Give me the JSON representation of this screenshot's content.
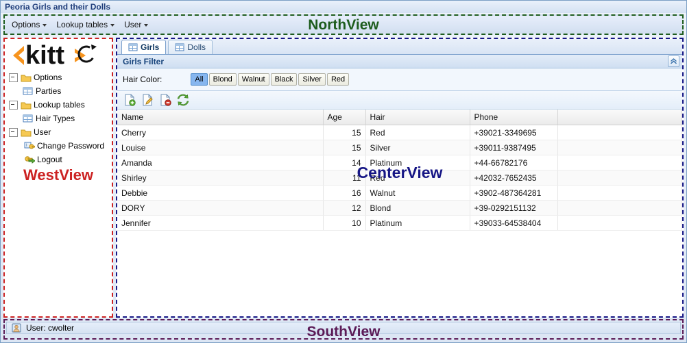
{
  "window": {
    "title": "Peoria Girls and their Dolls"
  },
  "regions": {
    "north_label": "NorthView",
    "west_label": "WestView",
    "center_label": "CenterView",
    "south_label": "SouthView",
    "north_color": "#1d5c1d",
    "west_color": "#cc2222",
    "center_color": "#161685",
    "south_color": "#5b1a56"
  },
  "menu": {
    "items": [
      {
        "label": "Options",
        "has_caret": true
      },
      {
        "label": "Lookup tables",
        "has_caret": true
      },
      {
        "label": "User",
        "has_caret": true
      }
    ]
  },
  "logo": {
    "text": "kitt",
    "accent_color": "#f7941e"
  },
  "tree": {
    "nodes": [
      {
        "label": "Options",
        "icon": "folder-icon",
        "type": "folder",
        "expanded": true,
        "level": 0
      },
      {
        "label": "Parties",
        "icon": "table-icon",
        "type": "leaf",
        "level": 1
      },
      {
        "label": "Lookup tables",
        "icon": "folder-icon",
        "type": "folder",
        "expanded": true,
        "level": 0
      },
      {
        "label": "Hair Types",
        "icon": "table-icon",
        "type": "leaf",
        "level": 1
      },
      {
        "label": "User",
        "icon": "folder-icon",
        "type": "folder",
        "expanded": true,
        "level": 0
      },
      {
        "label": "Change Password",
        "icon": "key-icon",
        "type": "leaf",
        "level": 1
      },
      {
        "label": "Logout",
        "icon": "logout-key-icon",
        "type": "leaf",
        "level": 1
      }
    ]
  },
  "tabs": [
    {
      "label": "Girls",
      "icon": "table-icon",
      "active": true
    },
    {
      "label": "Dolls",
      "icon": "table-icon",
      "active": false
    }
  ],
  "filter": {
    "title": "Girls Filter",
    "collapse_icon": "chevron-double-up-icon",
    "hair_color_label": "Hair Color:",
    "options": [
      {
        "label": "All",
        "selected": true
      },
      {
        "label": "Blond",
        "selected": false
      },
      {
        "label": "Walnut",
        "selected": false
      },
      {
        "label": "Black",
        "selected": false
      },
      {
        "label": "Silver",
        "selected": false
      },
      {
        "label": "Red",
        "selected": false
      }
    ]
  },
  "toolbar": {
    "buttons": [
      {
        "name": "new-record-button",
        "icon": "page-add-icon"
      },
      {
        "name": "edit-record-button",
        "icon": "page-edit-icon"
      },
      {
        "name": "delete-record-button",
        "icon": "page-delete-icon"
      },
      {
        "name": "refresh-button",
        "icon": "refresh-icon"
      }
    ]
  },
  "table": {
    "columns": [
      "Name",
      "Age",
      "Hair",
      "Phone",
      ""
    ],
    "rows": [
      {
        "name": "Cherry",
        "age": "15",
        "hair": "Red",
        "phone": "+39021-3349695"
      },
      {
        "name": "Louise",
        "age": "15",
        "hair": "Silver",
        "phone": "+39011-9387495"
      },
      {
        "name": "Amanda",
        "age": "14",
        "hair": "Platinum",
        "phone": "+44-66782176"
      },
      {
        "name": "Shirley",
        "age": "11",
        "hair": "Red",
        "phone": "+42032-7652435"
      },
      {
        "name": "Debbie",
        "age": "16",
        "hair": "Walnut",
        "phone": "+3902-487364281"
      },
      {
        "name": "DORY",
        "age": "12",
        "hair": "Blond",
        "phone": "+39-0292151132"
      },
      {
        "name": "Jennifer",
        "age": "10",
        "hair": "Platinum",
        "phone": "+39033-64538404"
      }
    ]
  },
  "status": {
    "icon": "user-icon",
    "text": "User: cwolter"
  }
}
